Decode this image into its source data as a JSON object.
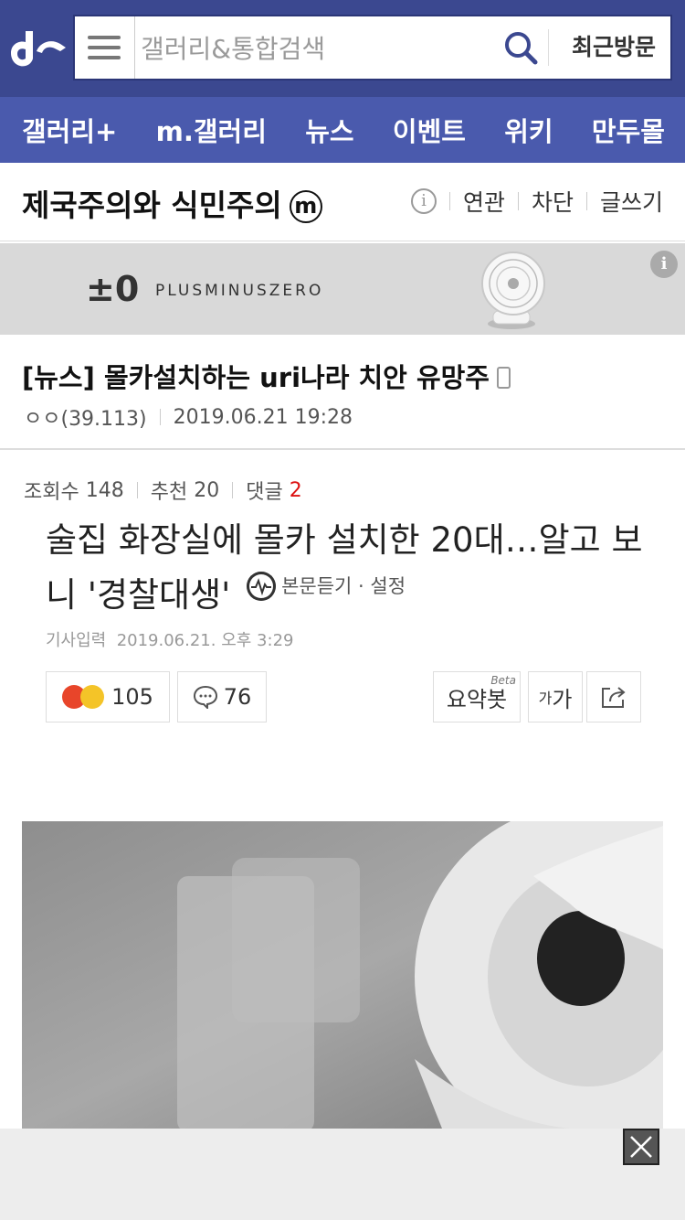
{
  "header": {
    "search_placeholder": "갤러리&통합검색",
    "recent_label": "최근방문"
  },
  "nav": [
    "갤러리+",
    "m.갤러리",
    "뉴스",
    "이벤트",
    "위키",
    "만두몰"
  ],
  "gallery": {
    "title": "제국주의와 식민주의",
    "badge": "m",
    "tools": [
      "연관",
      "차단",
      "글쓰기"
    ]
  },
  "ad": {
    "mark": "±0",
    "brand": "PLUSMINUSZERO",
    "info": "i"
  },
  "post": {
    "title": "[뉴스] 몰카설치하는 uri나라 치안 유망주",
    "author": "ㅇㅇ(39.113)",
    "datetime": "2019.06.21 19:28"
  },
  "stats": {
    "views_label": "조회수",
    "views": "148",
    "recommend_label": "추천",
    "recommend": "20",
    "comments_label": "댓글",
    "comments": "2"
  },
  "article": {
    "title": "술집 화장실에 몰카 설치한 20대…알고 보니 '경찰대생'",
    "listen_label": "본문듣기",
    "settings_label": "설정",
    "date_label": "기사입력",
    "date": "2019.06.21. 오후 3:29"
  },
  "reactions": {
    "emotion_count": "105",
    "comment_count": "76",
    "summary_label": "요약봇",
    "beta_label": "Beta",
    "font_small": "가",
    "font_large": "가"
  },
  "colors": {
    "header_bg": "#3b4890",
    "nav_bg": "#4a5aad",
    "comment_count": "#dd1111"
  }
}
